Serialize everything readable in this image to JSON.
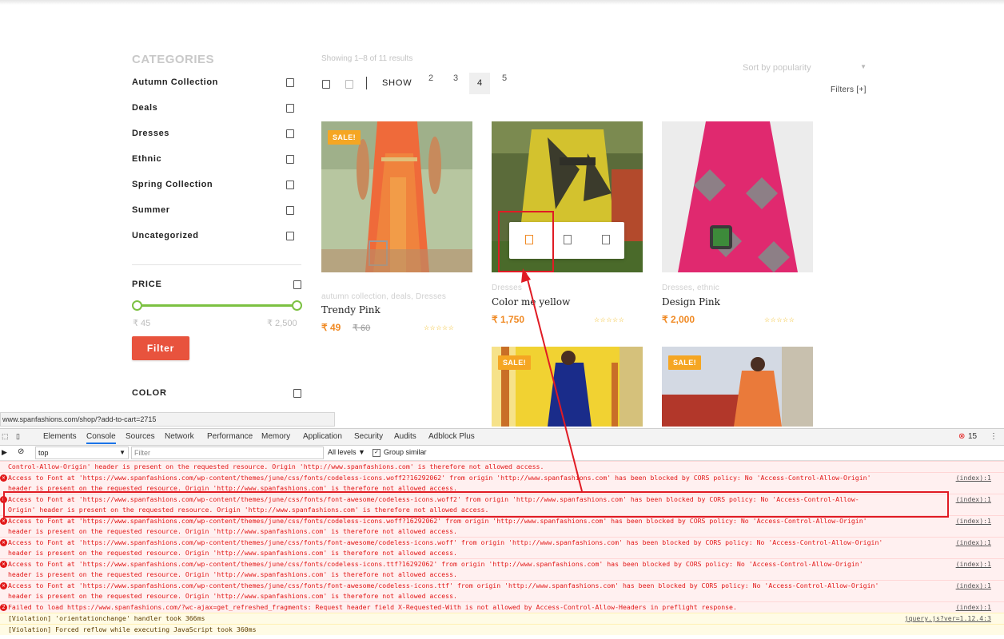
{
  "sidebar": {
    "categories_title": "CATEGORIES",
    "categories": [
      "Autumn Collection",
      "Deals",
      "Dresses",
      "Ethnic",
      "Spring Collection",
      "Summer",
      "Uncategorized"
    ],
    "price_title": "PRICE",
    "price_min": "₹ 45",
    "price_max": "₹ 2,500",
    "filter_button": "Filter",
    "color_title": "COLOR"
  },
  "toolbar": {
    "showing": "Showing 1–8 of 11 results",
    "sort_label": "Sort by popularity",
    "filters_label": "Filters [+]",
    "show_label": "SHOW",
    "per_row": [
      "2",
      "3",
      "4",
      "5"
    ],
    "active_per_row": "4"
  },
  "products": [
    {
      "sale": "SALE!",
      "categories": "autumn collection, deals, Dresses",
      "name": "Trendy Pink",
      "price": "₹ 49",
      "old_price": "₹ 60",
      "stars": "☆☆☆☆☆"
    },
    {
      "sale": "",
      "categories": "Dresses",
      "name": "Color me yellow",
      "price": "₹ 1,750",
      "old_price": "",
      "stars": "☆☆☆☆☆"
    },
    {
      "sale": "",
      "categories": "Dresses, ethnic",
      "name": "Design Pink",
      "price": "₹ 2,000",
      "old_price": "",
      "stars": "☆☆☆☆☆"
    },
    {
      "sale": "SALE!",
      "categories": "",
      "name": "",
      "price": "",
      "old_price": "",
      "stars": ""
    },
    {
      "sale": "SALE!",
      "categories": "",
      "name": "",
      "price": "",
      "old_price": "",
      "stars": ""
    }
  ],
  "status_url": "www.spanfashions.com/shop/?add-to-cart=2715",
  "devtools": {
    "tabs": [
      "Elements",
      "Console",
      "Sources",
      "Network",
      "Performance",
      "Memory",
      "Application",
      "Security",
      "Audits",
      "Adblock Plus"
    ],
    "active_tab": "Console",
    "error_count": "15",
    "context": "top",
    "filter_placeholder": "Filter",
    "levels": "All levels ▼",
    "group_similar": "Group similar",
    "messages": [
      {
        "level": "error",
        "icon": false,
        "text": "Control-Allow-Origin' header is present on the requested resource. Origin 'http://www.spanfashions.com' is therefore not allowed access.",
        "src": ""
      },
      {
        "level": "error",
        "icon": true,
        "text": "Access to Font at 'https://www.spanfashions.com/wp-content/themes/june/css/fonts/codeless-icons.woff2?16292062' from origin 'http://www.spanfashions.com' has been blocked by CORS policy: No 'Access-Control-Allow-Origin'",
        "text2": "header is present on the requested resource. Origin 'http://www.spanfashions.com' is therefore not allowed access.",
        "src": "(index):1"
      },
      {
        "level": "error",
        "icon": true,
        "text": "Access to Font at 'https://www.spanfashions.com/wp-content/themes/june/css/fonts/font-awesome/codeless-icons.woff2' from origin 'http://www.spanfashions.com' has been blocked by CORS policy: No 'Access-Control-Allow-",
        "text2": "Origin' header is present on the requested resource. Origin 'http://www.spanfashions.com' is therefore not allowed access.",
        "src": "(index):1"
      },
      {
        "level": "error",
        "icon": true,
        "text": "Access to Font at 'https://www.spanfashions.com/wp-content/themes/june/css/fonts/codeless-icons.woff?16292062' from origin 'http://www.spanfashions.com' has been blocked by CORS policy: No 'Access-Control-Allow-Origin'",
        "text2": "header is present on the requested resource. Origin 'http://www.spanfashions.com' is therefore not allowed access.",
        "src": "(index):1"
      },
      {
        "level": "error",
        "icon": true,
        "text": "Access to Font at 'https://www.spanfashions.com/wp-content/themes/june/css/fonts/font-awesome/codeless-icons.woff' from origin 'http://www.spanfashions.com' has been blocked by CORS policy: No 'Access-Control-Allow-Origin'",
        "text2": "header is present on the requested resource. Origin 'http://www.spanfashions.com' is therefore not allowed access.",
        "src": "(index):1"
      },
      {
        "level": "error",
        "icon": true,
        "text": "Access to Font at 'https://www.spanfashions.com/wp-content/themes/june/css/fonts/codeless-icons.ttf?16292062' from origin 'http://www.spanfashions.com' has been blocked by CORS policy: No 'Access-Control-Allow-Origin'",
        "text2": "header is present on the requested resource. Origin 'http://www.spanfashions.com' is therefore not allowed access.",
        "src": "(index):1"
      },
      {
        "level": "error",
        "icon": true,
        "text": "Access to Font at 'https://www.spanfashions.com/wp-content/themes/june/css/fonts/font-awesome/codeless-icons.ttf' from origin 'http://www.spanfashions.com' has been blocked by CORS policy: No 'Access-Control-Allow-Origin'",
        "text2": "header is present on the requested resource. Origin 'http://www.spanfashions.com' is therefore not allowed access.",
        "src": "(index):1"
      },
      {
        "level": "error",
        "icon": true,
        "badge": "2",
        "text": "Failed to load https://www.spanfashions.com/?wc-ajax=get_refreshed_fragments: Request header field X-Requested-With is not allowed by Access-Control-Allow-Headers in preflight response.",
        "src": "(index):1"
      },
      {
        "level": "warn",
        "icon": false,
        "text": "[Violation] 'orientationchange' handler took 366ms",
        "src": "jquery.js?ver=1.12.4:3"
      },
      {
        "level": "warn",
        "icon": false,
        "text": "[Violation] Forced reflow while executing JavaScript took 360ms",
        "src": ""
      }
    ]
  },
  "colors": {
    "accent": "#f08a24",
    "filter_btn": "#e8533d",
    "slider": "#7cc142",
    "sale": "#f5a623",
    "error": "#e21818",
    "highlight": "#e01b24"
  }
}
